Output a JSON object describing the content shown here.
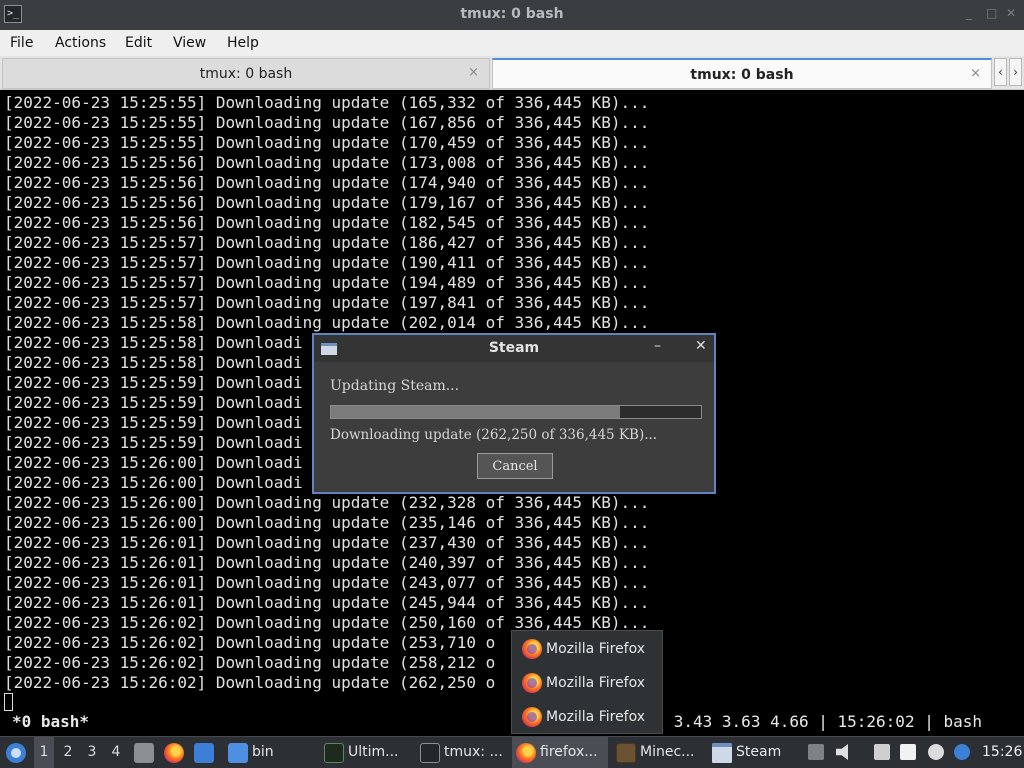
{
  "window": {
    "title": "tmux: 0 bash",
    "icon": "terminal-icon",
    "controls": [
      "minimize-icon",
      "maximize-icon",
      "close-icon"
    ]
  },
  "menu": {
    "file": "File",
    "actions": "Actions",
    "edit": "Edit",
    "view": "View",
    "help": "Help"
  },
  "tabs": [
    {
      "label": "tmux: 0 bash",
      "close": "×",
      "active": false
    },
    {
      "label": "tmux: 0 bash",
      "close": "×",
      "active": true
    }
  ],
  "tab_nav": {
    "prev": "‹",
    "next": "›"
  },
  "terminal": {
    "lines": [
      "[2022-06-23 15:25:55] Downloading update (165,332 of 336,445 KB)...",
      "[2022-06-23 15:25:55] Downloading update (167,856 of 336,445 KB)...",
      "[2022-06-23 15:25:55] Downloading update (170,459 of 336,445 KB)...",
      "[2022-06-23 15:25:56] Downloading update (173,008 of 336,445 KB)...",
      "[2022-06-23 15:25:56] Downloading update (174,940 of 336,445 KB)...",
      "[2022-06-23 15:25:56] Downloading update (179,167 of 336,445 KB)...",
      "[2022-06-23 15:25:56] Downloading update (182,545 of 336,445 KB)...",
      "[2022-06-23 15:25:57] Downloading update (186,427 of 336,445 KB)...",
      "[2022-06-23 15:25:57] Downloading update (190,411 of 336,445 KB)...",
      "[2022-06-23 15:25:57] Downloading update (194,489 of 336,445 KB)...",
      "[2022-06-23 15:25:57] Downloading update (197,841 of 336,445 KB)...",
      "[2022-06-23 15:25:58] Downloading update (202,014 of 336,445 KB)...",
      "[2022-06-23 15:25:58] Downloadi",
      "[2022-06-23 15:25:58] Downloadi",
      "[2022-06-23 15:25:59] Downloadi",
      "[2022-06-23 15:25:59] Downloadi",
      "[2022-06-23 15:25:59] Downloadi",
      "[2022-06-23 15:25:59] Downloadi",
      "[2022-06-23 15:26:00] Downloadi",
      "[2022-06-23 15:26:00] Downloadi",
      "[2022-06-23 15:26:00] Downloading update (232,328 of 336,445 KB)...",
      "[2022-06-23 15:26:00] Downloading update (235,146 of 336,445 KB)...",
      "[2022-06-23 15:26:01] Downloading update (237,430 of 336,445 KB)...",
      "[2022-06-23 15:26:01] Downloading update (240,397 of 336,445 KB)...",
      "[2022-06-23 15:26:01] Downloading update (243,077 of 336,445 KB)...",
      "[2022-06-23 15:26:01] Downloading update (245,944 of 336,445 KB)...",
      "[2022-06-23 15:26:02] Downloading update (250,160 of 336,445 KB)...",
      "[2022-06-23 15:26:02] Downloading update (253,710 o",
      "[2022-06-23 15:26:02] Downloading update (258,212 o",
      "[2022-06-23 15:26:02] Downloading update (262,250 o"
    ],
    "status_left": "*0 bash*",
    "status_right": "3.43 3.63 4.66 | 15:26:02 | bash"
  },
  "steam_dialog": {
    "title": "Steam",
    "minimize": "–",
    "close": "✕",
    "heading": "Updating Steam...",
    "progress": 0.78,
    "status": "Downloading update (262,250 of 336,445 KB)...",
    "cancel": "Cancel"
  },
  "firefox_popup": {
    "items": [
      "Mozilla Firefox",
      "Mozilla Firefox",
      "Mozilla Firefox"
    ]
  },
  "taskbar": {
    "workspaces": [
      "1",
      "2",
      "3",
      "4"
    ],
    "tasks": [
      {
        "label": "bin",
        "icon": "folder-icon",
        "active": false
      },
      {
        "label": "Ultim...",
        "icon": "terminal-icon",
        "active": false
      },
      {
        "label": "tmux: ...",
        "icon": "terminal-icon",
        "active": false
      },
      {
        "label": "firefox...",
        "icon": "firefox-icon",
        "active": true
      },
      {
        "label": "Minec...",
        "icon": "minecraft-icon",
        "active": false
      },
      {
        "label": "Steam",
        "icon": "window-icon",
        "active": false
      }
    ],
    "clock": "15:26"
  },
  "colors": {
    "terminal_bg": "#000000",
    "terminal_fg": "#e2e2e2",
    "accent": "#4a90d9",
    "steam_border": "#5f84c0",
    "taskbar_bg": "#2c2f33"
  }
}
